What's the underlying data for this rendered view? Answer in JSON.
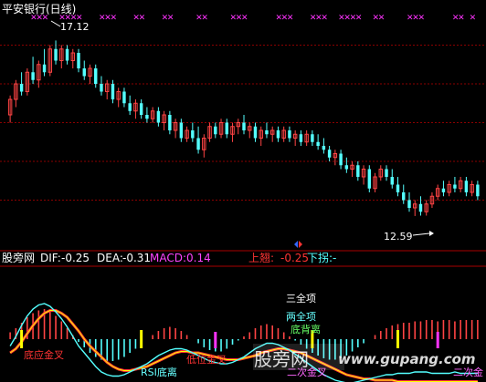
{
  "chart_data": [
    {
      "type": "candlestick",
      "title": "平安银行(日线)",
      "high_label": "17.12",
      "low_label": "12.59",
      "y_range": [
        12.0,
        17.6
      ],
      "gridlines": [
        13.0,
        14.0,
        15.0,
        16.0,
        17.0
      ],
      "bars": [
        {
          "o": 15.2,
          "h": 15.7,
          "l": 15.0,
          "c": 15.6
        },
        {
          "o": 15.6,
          "h": 16.1,
          "l": 15.4,
          "c": 16.0
        },
        {
          "o": 16.0,
          "h": 16.3,
          "l": 15.7,
          "c": 15.8
        },
        {
          "o": 15.8,
          "h": 16.4,
          "l": 15.7,
          "c": 16.3
        },
        {
          "o": 16.3,
          "h": 16.7,
          "l": 16.0,
          "c": 16.1
        },
        {
          "o": 16.1,
          "h": 16.6,
          "l": 15.9,
          "c": 16.5
        },
        {
          "o": 16.5,
          "h": 16.9,
          "l": 16.2,
          "c": 16.3
        },
        {
          "o": 16.3,
          "h": 17.0,
          "l": 16.2,
          "c": 16.9
        },
        {
          "o": 16.9,
          "h": 17.12,
          "l": 16.5,
          "c": 16.6
        },
        {
          "o": 16.6,
          "h": 17.0,
          "l": 16.4,
          "c": 16.9
        },
        {
          "o": 16.9,
          "h": 17.0,
          "l": 16.5,
          "c": 16.6
        },
        {
          "o": 16.6,
          "h": 16.9,
          "l": 16.4,
          "c": 16.8
        },
        {
          "o": 16.8,
          "h": 16.9,
          "l": 16.3,
          "c": 16.4
        },
        {
          "o": 16.4,
          "h": 16.6,
          "l": 16.1,
          "c": 16.2
        },
        {
          "o": 16.2,
          "h": 16.5,
          "l": 16.0,
          "c": 16.4
        },
        {
          "o": 16.4,
          "h": 16.5,
          "l": 15.9,
          "c": 16.0
        },
        {
          "o": 16.0,
          "h": 16.2,
          "l": 15.7,
          "c": 15.8
        },
        {
          "o": 15.8,
          "h": 16.1,
          "l": 15.6,
          "c": 16.0
        },
        {
          "o": 16.0,
          "h": 16.1,
          "l": 15.5,
          "c": 15.6
        },
        {
          "o": 15.6,
          "h": 15.9,
          "l": 15.4,
          "c": 15.8
        },
        {
          "o": 15.8,
          "h": 15.9,
          "l": 15.4,
          "c": 15.5
        },
        {
          "o": 15.5,
          "h": 15.7,
          "l": 15.2,
          "c": 15.3
        },
        {
          "o": 15.3,
          "h": 15.6,
          "l": 15.1,
          "c": 15.5
        },
        {
          "o": 15.5,
          "h": 15.6,
          "l": 15.1,
          "c": 15.2
        },
        {
          "o": 15.2,
          "h": 15.4,
          "l": 15.0,
          "c": 15.1
        },
        {
          "o": 15.1,
          "h": 15.4,
          "l": 15.0,
          "c": 15.3
        },
        {
          "o": 15.3,
          "h": 15.4,
          "l": 14.9,
          "c": 15.0
        },
        {
          "o": 15.0,
          "h": 15.3,
          "l": 14.8,
          "c": 15.2
        },
        {
          "o": 15.2,
          "h": 15.3,
          "l": 14.7,
          "c": 14.8
        },
        {
          "o": 14.8,
          "h": 15.1,
          "l": 14.6,
          "c": 15.0
        },
        {
          "o": 15.0,
          "h": 15.1,
          "l": 14.5,
          "c": 14.6
        },
        {
          "o": 14.6,
          "h": 14.9,
          "l": 14.5,
          "c": 14.8
        },
        {
          "o": 14.8,
          "h": 15.0,
          "l": 14.5,
          "c": 14.6
        },
        {
          "o": 14.6,
          "h": 14.9,
          "l": 14.2,
          "c": 14.3
        },
        {
          "o": 14.3,
          "h": 14.7,
          "l": 14.1,
          "c": 14.6
        },
        {
          "o": 14.6,
          "h": 15.0,
          "l": 14.5,
          "c": 14.9
        },
        {
          "o": 14.9,
          "h": 15.0,
          "l": 14.6,
          "c": 14.7
        },
        {
          "o": 14.7,
          "h": 15.1,
          "l": 14.6,
          "c": 15.0
        },
        {
          "o": 15.0,
          "h": 15.1,
          "l": 14.6,
          "c": 14.7
        },
        {
          "o": 14.7,
          "h": 15.0,
          "l": 14.5,
          "c": 14.9
        },
        {
          "o": 14.9,
          "h": 15.1,
          "l": 14.7,
          "c": 15.0
        },
        {
          "o": 15.0,
          "h": 15.2,
          "l": 14.7,
          "c": 14.8
        },
        {
          "o": 14.8,
          "h": 15.0,
          "l": 14.6,
          "c": 14.9
        },
        {
          "o": 14.9,
          "h": 15.0,
          "l": 14.5,
          "c": 14.6
        },
        {
          "o": 14.6,
          "h": 14.9,
          "l": 14.4,
          "c": 14.8
        },
        {
          "o": 14.8,
          "h": 15.0,
          "l": 14.6,
          "c": 14.7
        },
        {
          "o": 14.7,
          "h": 14.9,
          "l": 14.5,
          "c": 14.8
        },
        {
          "o": 14.8,
          "h": 14.9,
          "l": 14.5,
          "c": 14.6
        },
        {
          "o": 14.6,
          "h": 14.9,
          "l": 14.5,
          "c": 14.8
        },
        {
          "o": 14.8,
          "h": 14.9,
          "l": 14.5,
          "c": 14.6
        },
        {
          "o": 14.6,
          "h": 14.8,
          "l": 14.4,
          "c": 14.7
        },
        {
          "o": 14.7,
          "h": 14.8,
          "l": 14.4,
          "c": 14.5
        },
        {
          "o": 14.5,
          "h": 14.8,
          "l": 14.4,
          "c": 14.7
        },
        {
          "o": 14.7,
          "h": 14.8,
          "l": 14.4,
          "c": 14.5
        },
        {
          "o": 14.5,
          "h": 14.7,
          "l": 14.3,
          "c": 14.4
        },
        {
          "o": 14.4,
          "h": 14.6,
          "l": 14.2,
          "c": 14.3
        },
        {
          "o": 14.3,
          "h": 14.4,
          "l": 14.0,
          "c": 14.1
        },
        {
          "o": 14.1,
          "h": 14.3,
          "l": 13.9,
          "c": 14.2
        },
        {
          "o": 14.2,
          "h": 14.3,
          "l": 13.8,
          "c": 13.9
        },
        {
          "o": 13.9,
          "h": 14.1,
          "l": 13.7,
          "c": 13.8
        },
        {
          "o": 13.8,
          "h": 14.0,
          "l": 13.6,
          "c": 13.9
        },
        {
          "o": 13.9,
          "h": 14.0,
          "l": 13.5,
          "c": 13.6
        },
        {
          "o": 13.6,
          "h": 13.9,
          "l": 13.4,
          "c": 13.8
        },
        {
          "o": 13.8,
          "h": 13.9,
          "l": 13.2,
          "c": 13.3
        },
        {
          "o": 13.3,
          "h": 13.7,
          "l": 13.2,
          "c": 13.6
        },
        {
          "o": 13.6,
          "h": 13.9,
          "l": 13.5,
          "c": 13.8
        },
        {
          "o": 13.8,
          "h": 13.9,
          "l": 13.5,
          "c": 13.6
        },
        {
          "o": 13.6,
          "h": 13.8,
          "l": 13.3,
          "c": 13.4
        },
        {
          "o": 13.4,
          "h": 13.6,
          "l": 13.1,
          "c": 13.2
        },
        {
          "o": 13.2,
          "h": 13.4,
          "l": 12.9,
          "c": 13.0
        },
        {
          "o": 13.0,
          "h": 13.2,
          "l": 12.7,
          "c": 12.8
        },
        {
          "o": 12.8,
          "h": 13.0,
          "l": 12.59,
          "c": 12.9
        },
        {
          "o": 12.9,
          "h": 13.1,
          "l": 12.6,
          "c": 12.7
        },
        {
          "o": 12.7,
          "h": 13.0,
          "l": 12.6,
          "c": 12.9
        },
        {
          "o": 12.9,
          "h": 13.2,
          "l": 12.8,
          "c": 13.1
        },
        {
          "o": 13.1,
          "h": 13.4,
          "l": 13.0,
          "c": 13.3
        },
        {
          "o": 13.3,
          "h": 13.5,
          "l": 13.1,
          "c": 13.2
        },
        {
          "o": 13.2,
          "h": 13.5,
          "l": 13.1,
          "c": 13.4
        },
        {
          "o": 13.4,
          "h": 13.6,
          "l": 13.2,
          "c": 13.3
        },
        {
          "o": 13.3,
          "h": 13.6,
          "l": 13.2,
          "c": 13.5
        },
        {
          "o": 13.5,
          "h": 13.6,
          "l": 13.1,
          "c": 13.2
        },
        {
          "o": 13.2,
          "h": 13.5,
          "l": 13.1,
          "c": 13.4
        },
        {
          "o": 13.4,
          "h": 13.5,
          "l": 13.0,
          "c": 13.1
        }
      ],
      "top_markers": [
        4,
        5,
        6,
        9,
        10,
        11,
        12,
        16,
        17,
        18,
        22,
        23,
        27,
        28,
        33,
        34,
        39,
        40,
        41,
        47,
        48,
        49,
        53,
        54,
        55,
        58,
        59,
        60,
        61,
        64,
        65,
        70,
        71,
        72,
        78,
        79,
        81
      ]
    },
    {
      "type": "bar",
      "indicator": "股旁网",
      "dif_label": "DIF:",
      "dif_value": "-0.25",
      "dea_label": "DEA:",
      "dea_value": "-0.31",
      "macd_label": "MACD:",
      "macd_value": "0.14",
      "up_label": "上翘:",
      "up_value": "-0.25",
      "down_label": "下拐:",
      "down_value": "-",
      "signals": [
        {
          "text": "底应金叉",
          "color": "#ff3333"
        },
        {
          "text": "RSI底离",
          "color": "#66ffff"
        },
        {
          "text": "低位金叉",
          "color": "#ff3333"
        },
        {
          "text": "三全项",
          "color": "#ffffff"
        },
        {
          "text": "两全项",
          "color": "#66ffff"
        },
        {
          "text": "底背离",
          "color": "#66ff66"
        },
        {
          "text": "二次金叉",
          "color": "#ff66ff"
        },
        {
          "text": "二次金",
          "color": "#ff66ff"
        }
      ],
      "histogram": [
        0.05,
        0.08,
        0.12,
        0.16,
        0.19,
        0.21,
        0.22,
        0.2,
        0.17,
        0.13,
        0.08,
        0.03,
        -0.02,
        -0.06,
        -0.1,
        -0.13,
        -0.15,
        -0.16,
        -0.16,
        -0.15,
        -0.13,
        -0.1,
        -0.07,
        -0.04,
        0.0,
        0.03,
        0.06,
        0.08,
        0.09,
        0.08,
        0.06,
        0.03,
        0.0,
        -0.03,
        -0.06,
        -0.08,
        -0.09,
        -0.09,
        -0.07,
        -0.04,
        -0.01,
        0.02,
        0.05,
        0.08,
        0.1,
        0.11,
        0.1,
        0.08,
        0.05,
        0.02,
        -0.01,
        -0.04,
        -0.07,
        -0.1,
        -0.12,
        -0.14,
        -0.15,
        -0.15,
        -0.14,
        -0.12,
        -0.09,
        -0.06,
        -0.03,
        0.0,
        0.03,
        0.06,
        0.08,
        0.1,
        0.11,
        0.12,
        0.12,
        0.13,
        0.13,
        0.14,
        0.14,
        0.13,
        0.14,
        0.14,
        0.13,
        0.14,
        0.14,
        0.14,
        0.14
      ],
      "dif_line": [
        -0.05,
        0.02,
        0.1,
        0.17,
        0.22,
        0.25,
        0.26,
        0.24,
        0.2,
        0.15,
        0.09,
        0.02,
        -0.05,
        -0.1,
        -0.15,
        -0.2,
        -0.24,
        -0.26,
        -0.27,
        -0.27,
        -0.26,
        -0.24,
        -0.22,
        -0.2,
        -0.18,
        -0.15,
        -0.12,
        -0.1,
        -0.08,
        -0.07,
        -0.07,
        -0.08,
        -0.1,
        -0.12,
        -0.14,
        -0.16,
        -0.17,
        -0.18,
        -0.18,
        -0.17,
        -0.15,
        -0.13,
        -0.1,
        -0.07,
        -0.05,
        -0.03,
        -0.03,
        -0.04,
        -0.06,
        -0.08,
        -0.11,
        -0.14,
        -0.17,
        -0.2,
        -0.23,
        -0.26,
        -0.28,
        -0.3,
        -0.31,
        -0.32,
        -0.32,
        -0.31,
        -0.3,
        -0.29,
        -0.28,
        -0.27,
        -0.26,
        -0.26,
        -0.25,
        -0.25,
        -0.25,
        -0.24,
        -0.24,
        -0.24,
        -0.25,
        -0.25,
        -0.25,
        -0.25,
        -0.24,
        -0.25,
        -0.25,
        -0.25,
        -0.25
      ],
      "dea_line": [
        -0.1,
        -0.07,
        -0.02,
        0.04,
        0.1,
        0.15,
        0.19,
        0.21,
        0.21,
        0.19,
        0.16,
        0.11,
        0.06,
        0.0,
        -0.05,
        -0.09,
        -0.13,
        -0.17,
        -0.2,
        -0.22,
        -0.23,
        -0.23,
        -0.22,
        -0.21,
        -0.2,
        -0.18,
        -0.16,
        -0.14,
        -0.12,
        -0.1,
        -0.09,
        -0.09,
        -0.1,
        -0.1,
        -0.11,
        -0.12,
        -0.13,
        -0.14,
        -0.15,
        -0.15,
        -0.15,
        -0.14,
        -0.13,
        -0.12,
        -0.1,
        -0.09,
        -0.08,
        -0.07,
        -0.07,
        -0.08,
        -0.09,
        -0.1,
        -0.12,
        -0.14,
        -0.16,
        -0.18,
        -0.2,
        -0.22,
        -0.24,
        -0.26,
        -0.27,
        -0.28,
        -0.29,
        -0.29,
        -0.3,
        -0.3,
        -0.3,
        -0.3,
        -0.31,
        -0.31,
        -0.31,
        -0.31,
        -0.31,
        -0.31,
        -0.31,
        -0.31,
        -0.31,
        -0.31,
        -0.31,
        -0.31,
        -0.31,
        -0.31,
        -0.31
      ],
      "yellow_markers": [
        2,
        23,
        53,
        68
      ],
      "magenta_markers": [
        36,
        75
      ]
    }
  ],
  "watermark": {
    "cn": "股旁网",
    "url": "www.gupang.com"
  },
  "colors": {
    "up": "#ff4444",
    "down": "#54ffff",
    "grid": "#8b0000",
    "marker": "#ff33ff",
    "dif": "#ffffff",
    "dea": "#ffff00"
  }
}
